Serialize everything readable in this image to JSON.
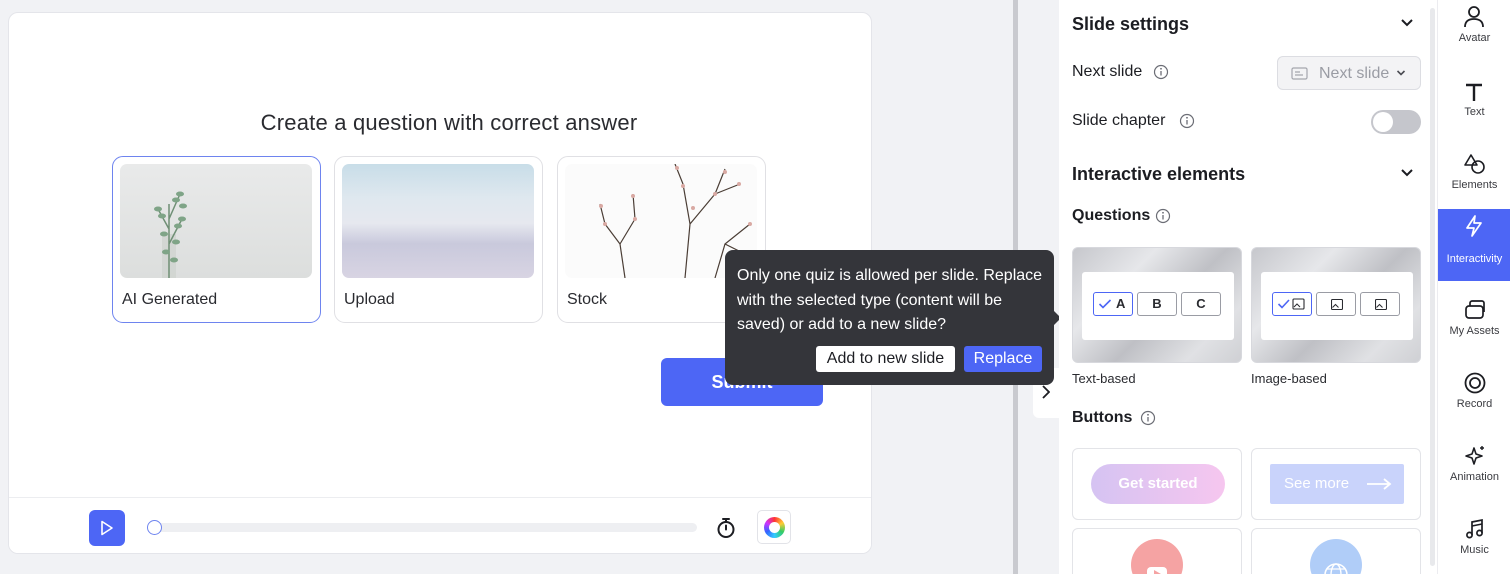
{
  "canvas": {
    "question_title": "Create a question with correct answer",
    "options": [
      {
        "label": "AI Generated",
        "selected": true
      },
      {
        "label": "Upload",
        "selected": false
      },
      {
        "label": "Stock",
        "selected": false
      }
    ],
    "submit_label": "Submit"
  },
  "player": {
    "progress": 0
  },
  "tooltip": {
    "message": "Only one quiz is allowed per slide. Replace with the selected type (content will be saved) or add to a new slide?",
    "add_label": "Add to new slide",
    "replace_label": "Replace"
  },
  "panel": {
    "slide_settings_title": "Slide settings",
    "next_slide_label": "Next slide",
    "next_slide_value": "Next slide",
    "slide_chapter_label": "Slide chapter",
    "slide_chapter_on": false,
    "interactive_title": "Interactive elements",
    "questions_title": "Questions",
    "question_types": [
      {
        "caption": "Text-based",
        "chips": [
          "A",
          "B",
          "C"
        ]
      },
      {
        "caption": "Image-based"
      }
    ],
    "buttons_title": "Buttons",
    "button_samples": [
      "Get started",
      "See more"
    ]
  },
  "rail": {
    "items": [
      {
        "label": "Avatar",
        "icon": "person-icon"
      },
      {
        "label": "Text",
        "icon": "text-icon"
      },
      {
        "label": "Elements",
        "icon": "shapes-icon"
      },
      {
        "label": "Interactivity",
        "icon": "lightning-icon",
        "active": true
      },
      {
        "label": "My Assets",
        "icon": "assets-icon"
      },
      {
        "label": "Record",
        "icon": "record-icon"
      },
      {
        "label": "Animation",
        "icon": "sparkle-icon"
      },
      {
        "label": "Music",
        "icon": "music-icon"
      }
    ]
  },
  "colors": {
    "accent": "#4d66f5",
    "tooltip_bg": "#34353a"
  }
}
